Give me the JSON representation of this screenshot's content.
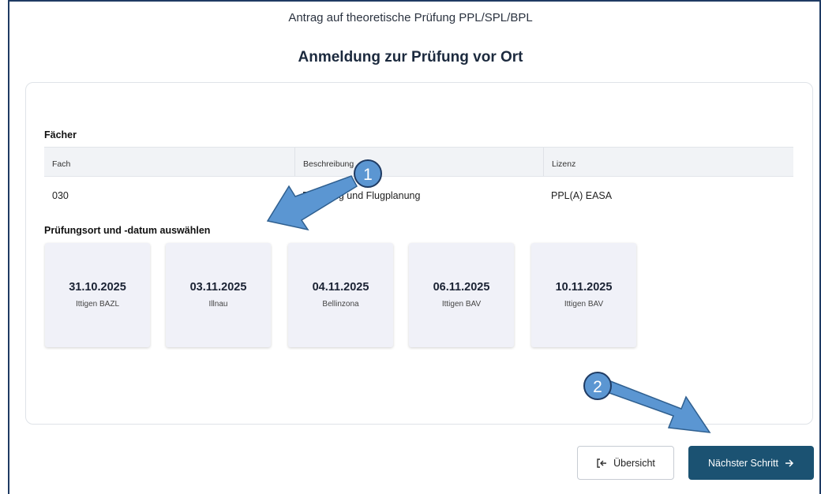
{
  "header": {
    "subtitle": "Antrag auf theoretische Prüfung PPL/SPL/BPL",
    "title": "Anmeldung zur Prüfung vor Ort"
  },
  "subjects": {
    "section_label": "Fächer",
    "columns": [
      "Fach",
      "Beschreibung",
      "Lizenz"
    ],
    "rows": [
      {
        "fach": "030",
        "beschreibung": "Beladung und Flugplanung",
        "lizenz": "PPL(A) EASA"
      }
    ]
  },
  "exam": {
    "section_label": "Prüfungsort und -datum auswählen",
    "options": [
      {
        "date": "31.10.2025",
        "place": "Ittigen BAZL"
      },
      {
        "date": "03.11.2025",
        "place": "Illnau"
      },
      {
        "date": "04.11.2025",
        "place": "Bellinzona"
      },
      {
        "date": "06.11.2025",
        "place": "Ittigen BAV"
      },
      {
        "date": "10.11.2025",
        "place": "Ittigen BAV"
      }
    ]
  },
  "buttons": {
    "overview_label": "Übersicht",
    "overview_icon": "exit-icon",
    "next_label": "Nächster Schritt",
    "next_icon": "arrow-right-icon"
  },
  "annotations": {
    "badge_1": "1",
    "badge_2": "2",
    "color": "#5b96d2"
  },
  "colors": {
    "primary_button": "#1b5272",
    "card_background": "#f0f1f8",
    "frame_border": "#1f3b63"
  }
}
